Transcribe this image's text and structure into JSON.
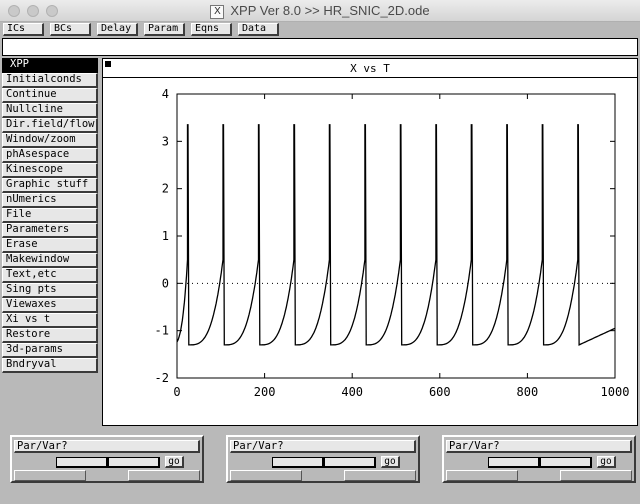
{
  "window": {
    "title": "XPP Ver 8.0 >> HR_SNIC_2D.ode"
  },
  "toolbar": {
    "buttons": [
      "ICs",
      "BCs",
      "Delay",
      "Param",
      "Eqns",
      "Data"
    ]
  },
  "menu": {
    "header": "XPP",
    "items": [
      "Initialconds",
      "Continue",
      "Nullcline",
      "Dir.field/flow",
      "Window/zoom",
      "phAsespace",
      "Kinescope",
      "Graphic stuff",
      "nUmerics",
      "File",
      "Parameters",
      "Erase",
      "Makewindow",
      "Text,etc",
      "Sing pts",
      "Viewaxes",
      "Xi vs t",
      "Restore",
      "3d-params",
      "Bndryval"
    ]
  },
  "plot": {
    "title": "X vs T"
  },
  "chart_data": {
    "type": "line",
    "title": "X vs T",
    "xlabel": "",
    "ylabel": "",
    "xlim": [
      0,
      1000
    ],
    "ylim": [
      -2,
      4
    ],
    "x_ticks": [
      0,
      200,
      400,
      600,
      800,
      1000
    ],
    "y_ticks": [
      -2,
      -1,
      0,
      1,
      2,
      3,
      4
    ],
    "baseline_y": 0,
    "spike_times": [
      24,
      105,
      186,
      267,
      348,
      429,
      510,
      591,
      672,
      753,
      834,
      915
    ],
    "spike_peak": 3.35,
    "trough": -1.3,
    "initial_value": -0.85,
    "final_value": -0.95,
    "series": [
      {
        "color": "#000000"
      }
    ]
  },
  "sliders": [
    {
      "label": "Par/Var?",
      "go": "go",
      "thumb": 0.5
    },
    {
      "label": "Par/Var?",
      "go": "go",
      "thumb": 0.5
    },
    {
      "label": "Par/Var?",
      "go": "go",
      "thumb": 0.5
    }
  ]
}
